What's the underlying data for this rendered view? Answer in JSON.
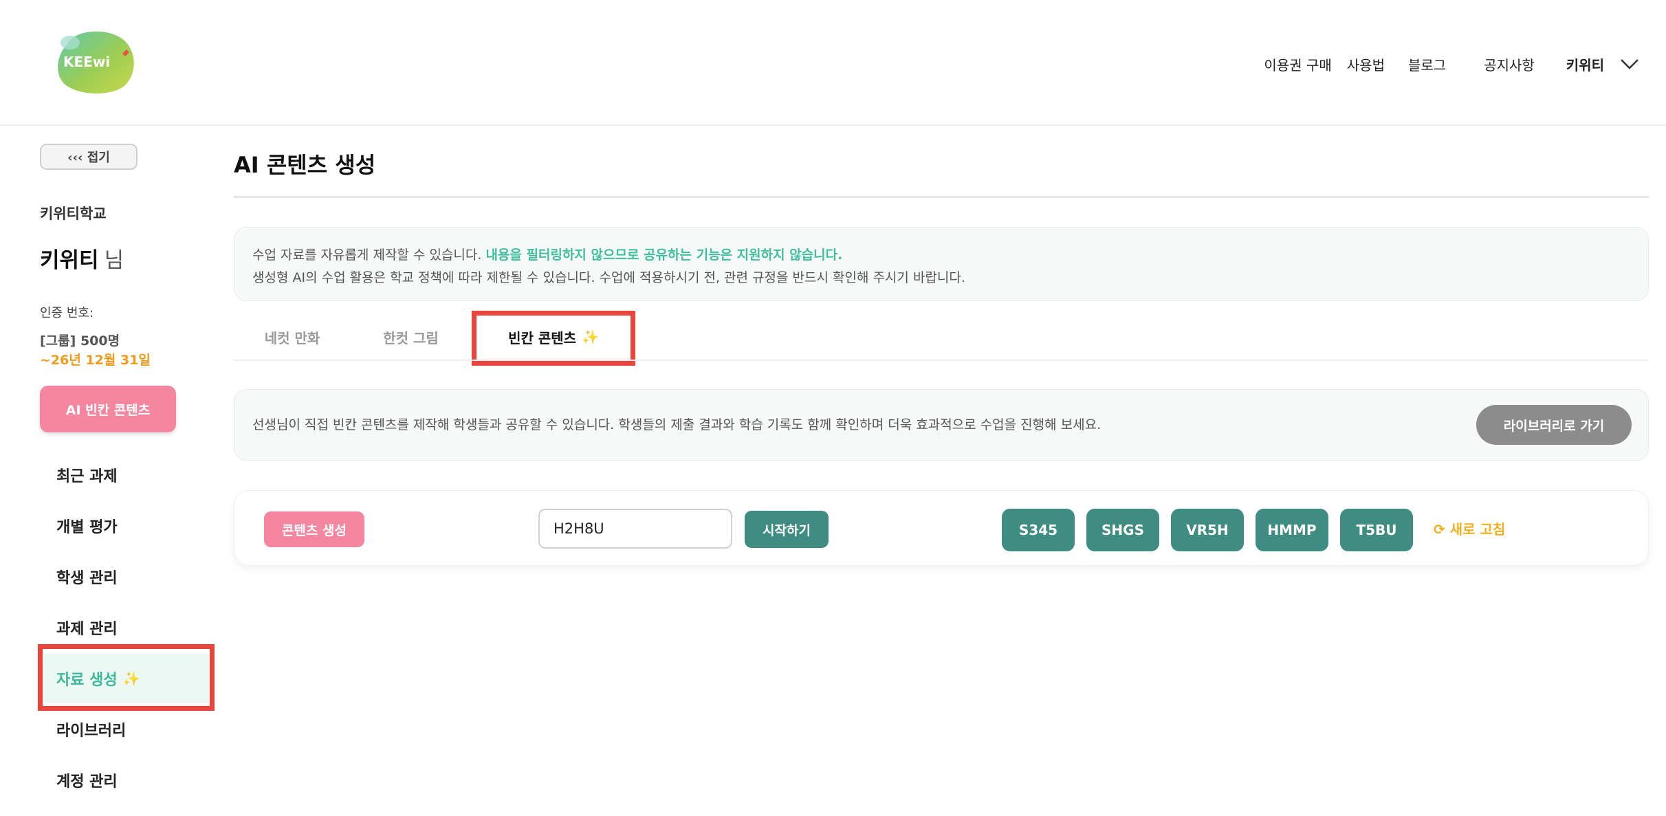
{
  "header": {
    "logo_text": "KEEwi",
    "nav": [
      "이용권 구매",
      "사용법",
      "블로그",
      "공지사항"
    ],
    "user_name": "키위티",
    "icons": {
      "chevron": "chevron-down-icon"
    }
  },
  "sidebar": {
    "collapse_label": "‹‹‹ 접기",
    "school": "키위티학교",
    "user": "키위티",
    "user_suffix": "님",
    "cert_label": "인증 번호:",
    "cert_group": "[그룹] 500명",
    "cert_date": "~26년 12월 31일",
    "ai_blank_button": "AI 빈칸 콘텐츠",
    "menu": [
      "최근 과제",
      "개별 평가",
      "학생 관리",
      "과제 관리",
      "자료 생성",
      "라이브러리",
      "계정 관리"
    ],
    "active_menu": "자료 생성"
  },
  "main": {
    "title": "AI 콘텐츠 생성",
    "notice": {
      "line1_prefix": "수업 자료를 자유롭게 제작할 수 있습니다. ",
      "line1_accent": "내용을 필터링하지 않으므로 공유하는 기능은 지원하지 않습니다.",
      "line2": "생성형 AI의 수업 활용은 학교 정책에 따라 제한될 수 있습니다. 수업에 적용하시기 전, 관련 규정을 반드시 확인해 주시기 바랍니다."
    },
    "tabs": [
      "네컷 만화",
      "한컷 그림",
      "빈칸 콘텐츠"
    ],
    "active_tab": "빈칸 콘텐츠",
    "description": "선생님이 직접 빈칸 콘텐츠를 제작해 학생들과 공유할 수 있습니다. 학생들의 제출 결과와 학습 기록도 함께 확인하며 더욱 효과적으로 수업을 진행해 보세요.",
    "library_button": "라이브러리로 가기",
    "create_button": "콘텐츠 생성",
    "code_input_value": "H2H8U",
    "start_button": "시작하기",
    "codes": [
      "S345",
      "SHGS",
      "VR5H",
      "HMMP",
      "T5BU"
    ],
    "refresh_label": "새로 고침"
  },
  "colors": {
    "accent_green": "#3fb79b",
    "pink": "#f4869f",
    "teal": "#3f8c82",
    "orange": "#f29b1a",
    "highlight_red": "#e8453c"
  }
}
